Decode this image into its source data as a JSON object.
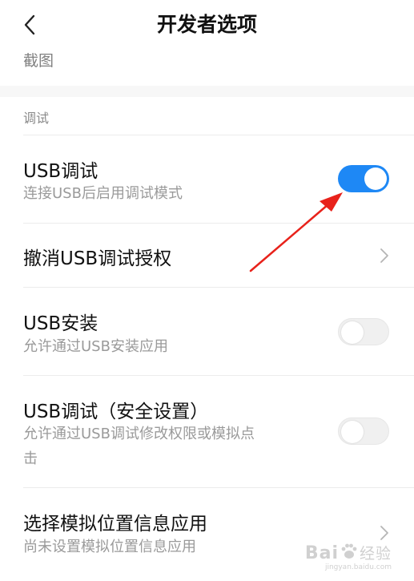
{
  "header": {
    "title": "开发者选项",
    "back_icon": "chevron-left-icon"
  },
  "screenshot_row": {
    "label": "截图"
  },
  "section": {
    "title": "调试"
  },
  "items": [
    {
      "title": "USB调试",
      "subtitle": "连接USB后启用调试模式",
      "control": "toggle",
      "state": "on"
    },
    {
      "title": "撤消USB调试授权",
      "control": "chevron"
    },
    {
      "title": "USB安装",
      "subtitle": "允许通过USB安装应用",
      "control": "toggle",
      "state": "off"
    },
    {
      "title": "USB调试（安全设置）",
      "subtitle_line1": "允许通过USB调试修改权限或模拟点",
      "subtitle_line2": "击",
      "control": "toggle",
      "state": "off"
    },
    {
      "title": "选择模拟位置信息应用",
      "subtitle": "尚未设置模拟位置信息应用",
      "control": "chevron"
    }
  ],
  "watermark": {
    "brand_left": "Bai",
    "brand_right": "经验",
    "sub": "jingyan.baidu.com"
  },
  "colors": {
    "accent": "#1e88f5",
    "annotation_arrow": "#e8221b"
  }
}
